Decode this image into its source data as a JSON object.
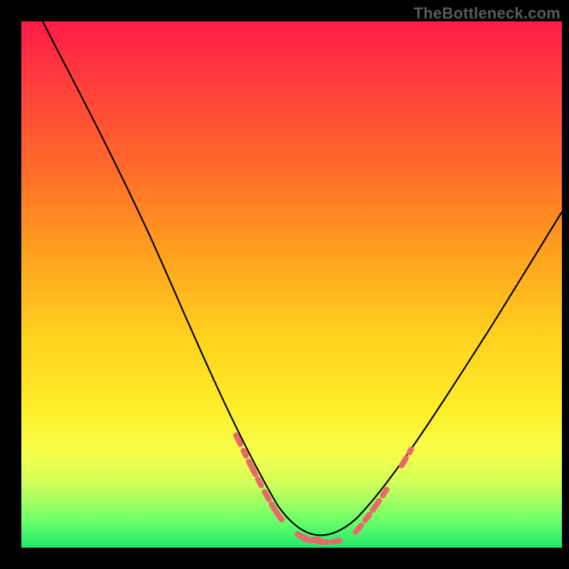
{
  "watermark": "TheBottleneck.com",
  "chart_data": {
    "type": "line",
    "title": "",
    "xlabel": "",
    "ylabel": "",
    "xlim": [
      0,
      100
    ],
    "ylim": [
      0,
      100
    ],
    "grid": false,
    "legend": false,
    "series": [
      {
        "name": "curve",
        "x": [
          4,
          10,
          18,
          26,
          34,
          42,
          48,
          52,
          56,
          60,
          64,
          70,
          78,
          86,
          94,
          100
        ],
        "values": [
          100,
          90,
          78,
          64,
          48,
          30,
          16,
          8,
          3,
          2,
          3,
          8,
          20,
          34,
          46,
          55
        ]
      }
    ],
    "highlight_ranges_x": [
      [
        40,
        52
      ],
      [
        64,
        72
      ]
    ],
    "annotations": []
  },
  "colors": {
    "curve": "#000000",
    "highlight": "#e9696b",
    "background_top": "#ff1a48",
    "background_bottom": "#20e86a",
    "frame": "#000000"
  }
}
